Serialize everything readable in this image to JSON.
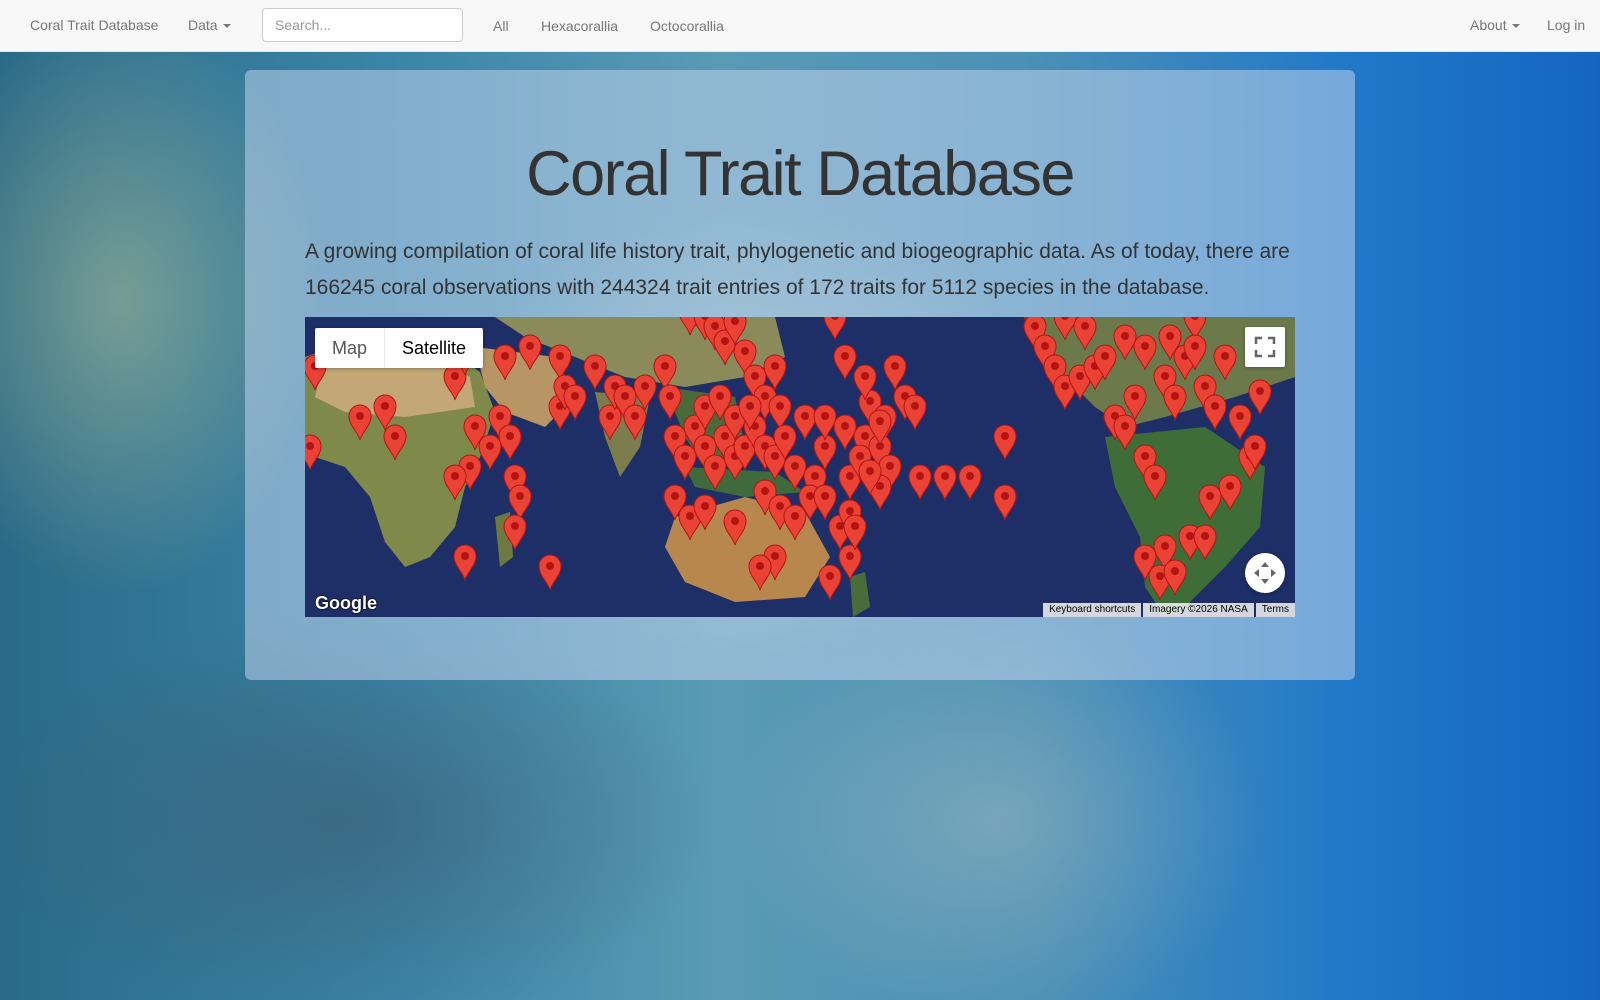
{
  "navbar": {
    "brand": "Coral Trait Database",
    "data_menu": "Data",
    "search_placeholder": "Search...",
    "filters": [
      "All",
      "Hexacorallia",
      "Octocorallia"
    ],
    "about_menu": "About",
    "login": "Log in"
  },
  "jumbotron": {
    "title": "Coral Trait Database",
    "lead": "A growing compilation of coral life history trait, phylogenetic and biogeographic data. As of today, there are 166245 coral observations with 244324 trait entries of 172 traits for 5112 species in the database."
  },
  "map": {
    "map_type_options": [
      "Map",
      "Satellite"
    ],
    "selected_type": "Satellite",
    "google_logo": "Google",
    "attribution": {
      "shortcuts": "Keyboard shortcuts",
      "imagery": "Imagery ©2026 NASA",
      "terms": "Terms"
    },
    "marker_color": "#ea4335"
  },
  "colors": {
    "navbar_bg": "#f8f8f8",
    "nav_text": "#777777",
    "title_text": "#333333",
    "ocean": "#1e2f68"
  }
}
